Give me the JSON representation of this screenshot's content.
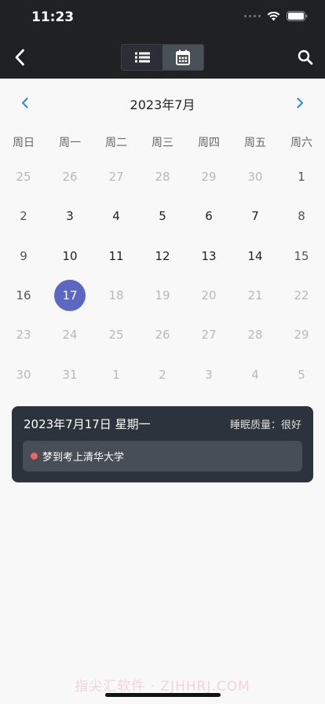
{
  "status": {
    "time": "11:23"
  },
  "nav": {
    "back_icon": "chevron-left-icon",
    "search_icon": "search-icon"
  },
  "segment": {
    "list_icon": "list-icon",
    "calendar_icon": "calendar-icon",
    "active": "calendar"
  },
  "calendar": {
    "month_title": "2023年7月",
    "weekdays": [
      "周日",
      "周一",
      "周二",
      "周三",
      "周四",
      "周五",
      "周六"
    ],
    "days": [
      {
        "n": "25",
        "muted": true
      },
      {
        "n": "26",
        "muted": true
      },
      {
        "n": "27",
        "muted": true
      },
      {
        "n": "28",
        "muted": true
      },
      {
        "n": "29",
        "muted": true
      },
      {
        "n": "30",
        "muted": true
      },
      {
        "n": "1",
        "muted": false
      },
      {
        "n": "2",
        "muted": false
      },
      {
        "n": "3",
        "muted": false
      },
      {
        "n": "4",
        "muted": false
      },
      {
        "n": "5",
        "muted": false
      },
      {
        "n": "6",
        "muted": false
      },
      {
        "n": "7",
        "muted": false
      },
      {
        "n": "8",
        "muted": false
      },
      {
        "n": "9",
        "muted": false
      },
      {
        "n": "10",
        "muted": false
      },
      {
        "n": "11",
        "muted": false
      },
      {
        "n": "12",
        "muted": false
      },
      {
        "n": "13",
        "muted": false
      },
      {
        "n": "14",
        "muted": false
      },
      {
        "n": "15",
        "muted": false
      },
      {
        "n": "16",
        "muted": false
      },
      {
        "n": "17",
        "muted": false,
        "selected": true
      },
      {
        "n": "18",
        "muted": true
      },
      {
        "n": "19",
        "muted": true
      },
      {
        "n": "20",
        "muted": true
      },
      {
        "n": "21",
        "muted": true
      },
      {
        "n": "22",
        "muted": true
      },
      {
        "n": "23",
        "muted": true
      },
      {
        "n": "24",
        "muted": true
      },
      {
        "n": "25",
        "muted": true
      },
      {
        "n": "26",
        "muted": true
      },
      {
        "n": "27",
        "muted": true
      },
      {
        "n": "28",
        "muted": true
      },
      {
        "n": "29",
        "muted": true
      },
      {
        "n": "30",
        "muted": true
      },
      {
        "n": "31",
        "muted": true
      },
      {
        "n": "1",
        "muted": true
      },
      {
        "n": "2",
        "muted": true
      },
      {
        "n": "3",
        "muted": true
      },
      {
        "n": "4",
        "muted": true
      },
      {
        "n": "5",
        "muted": true
      }
    ]
  },
  "detail": {
    "date": "2023年7月17日 星期一",
    "quality": "睡眠质量：很好",
    "dreams": [
      {
        "text": "梦到考上清华大学",
        "color": "#f06363"
      }
    ]
  },
  "watermark": "指尖汇软件 · ZJHHRJ.COM",
  "colors": {
    "accent": "#5b67c2",
    "header_bg": "#1f2123",
    "card_bg": "#2d333c",
    "nav_arrow": "#2d8fd6"
  }
}
